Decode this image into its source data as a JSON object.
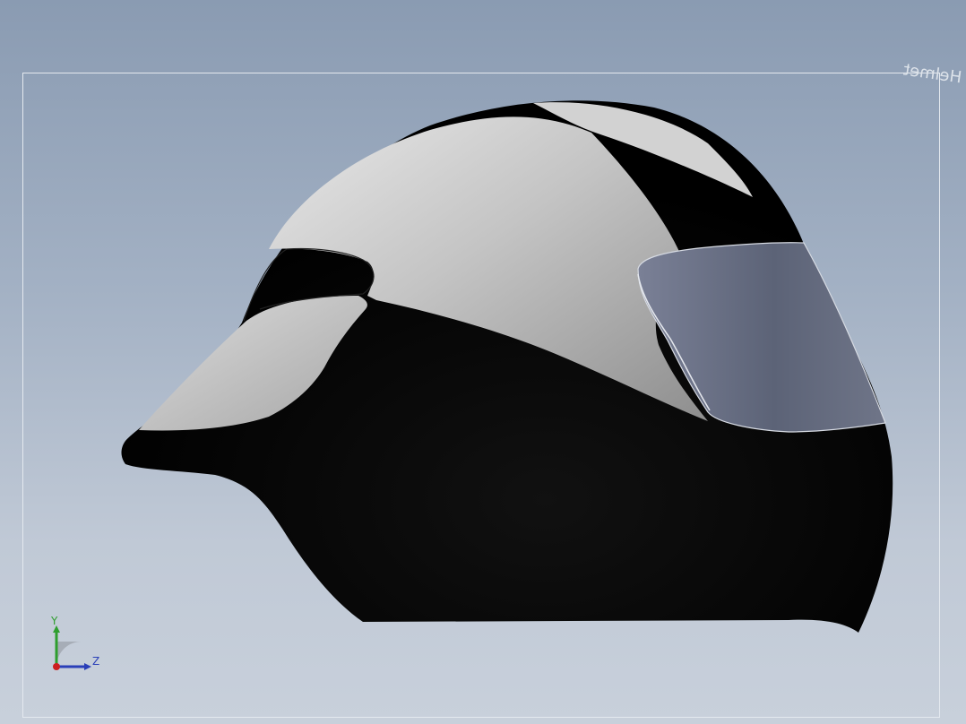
{
  "viewport": {
    "background_top": "#8a9bb2",
    "background_bottom": "#c8d0db"
  },
  "sheet": {
    "label": "Helmet"
  },
  "model": {
    "shell_color": "#000000",
    "panel_color": "#c8c8c8",
    "visor_color": "#5f667c"
  },
  "triad": {
    "y_label": "Y",
    "z_label": "Z",
    "y_color": "#2e9e2e",
    "z_color": "#2a3fb8",
    "x_color": "#cc2020"
  }
}
